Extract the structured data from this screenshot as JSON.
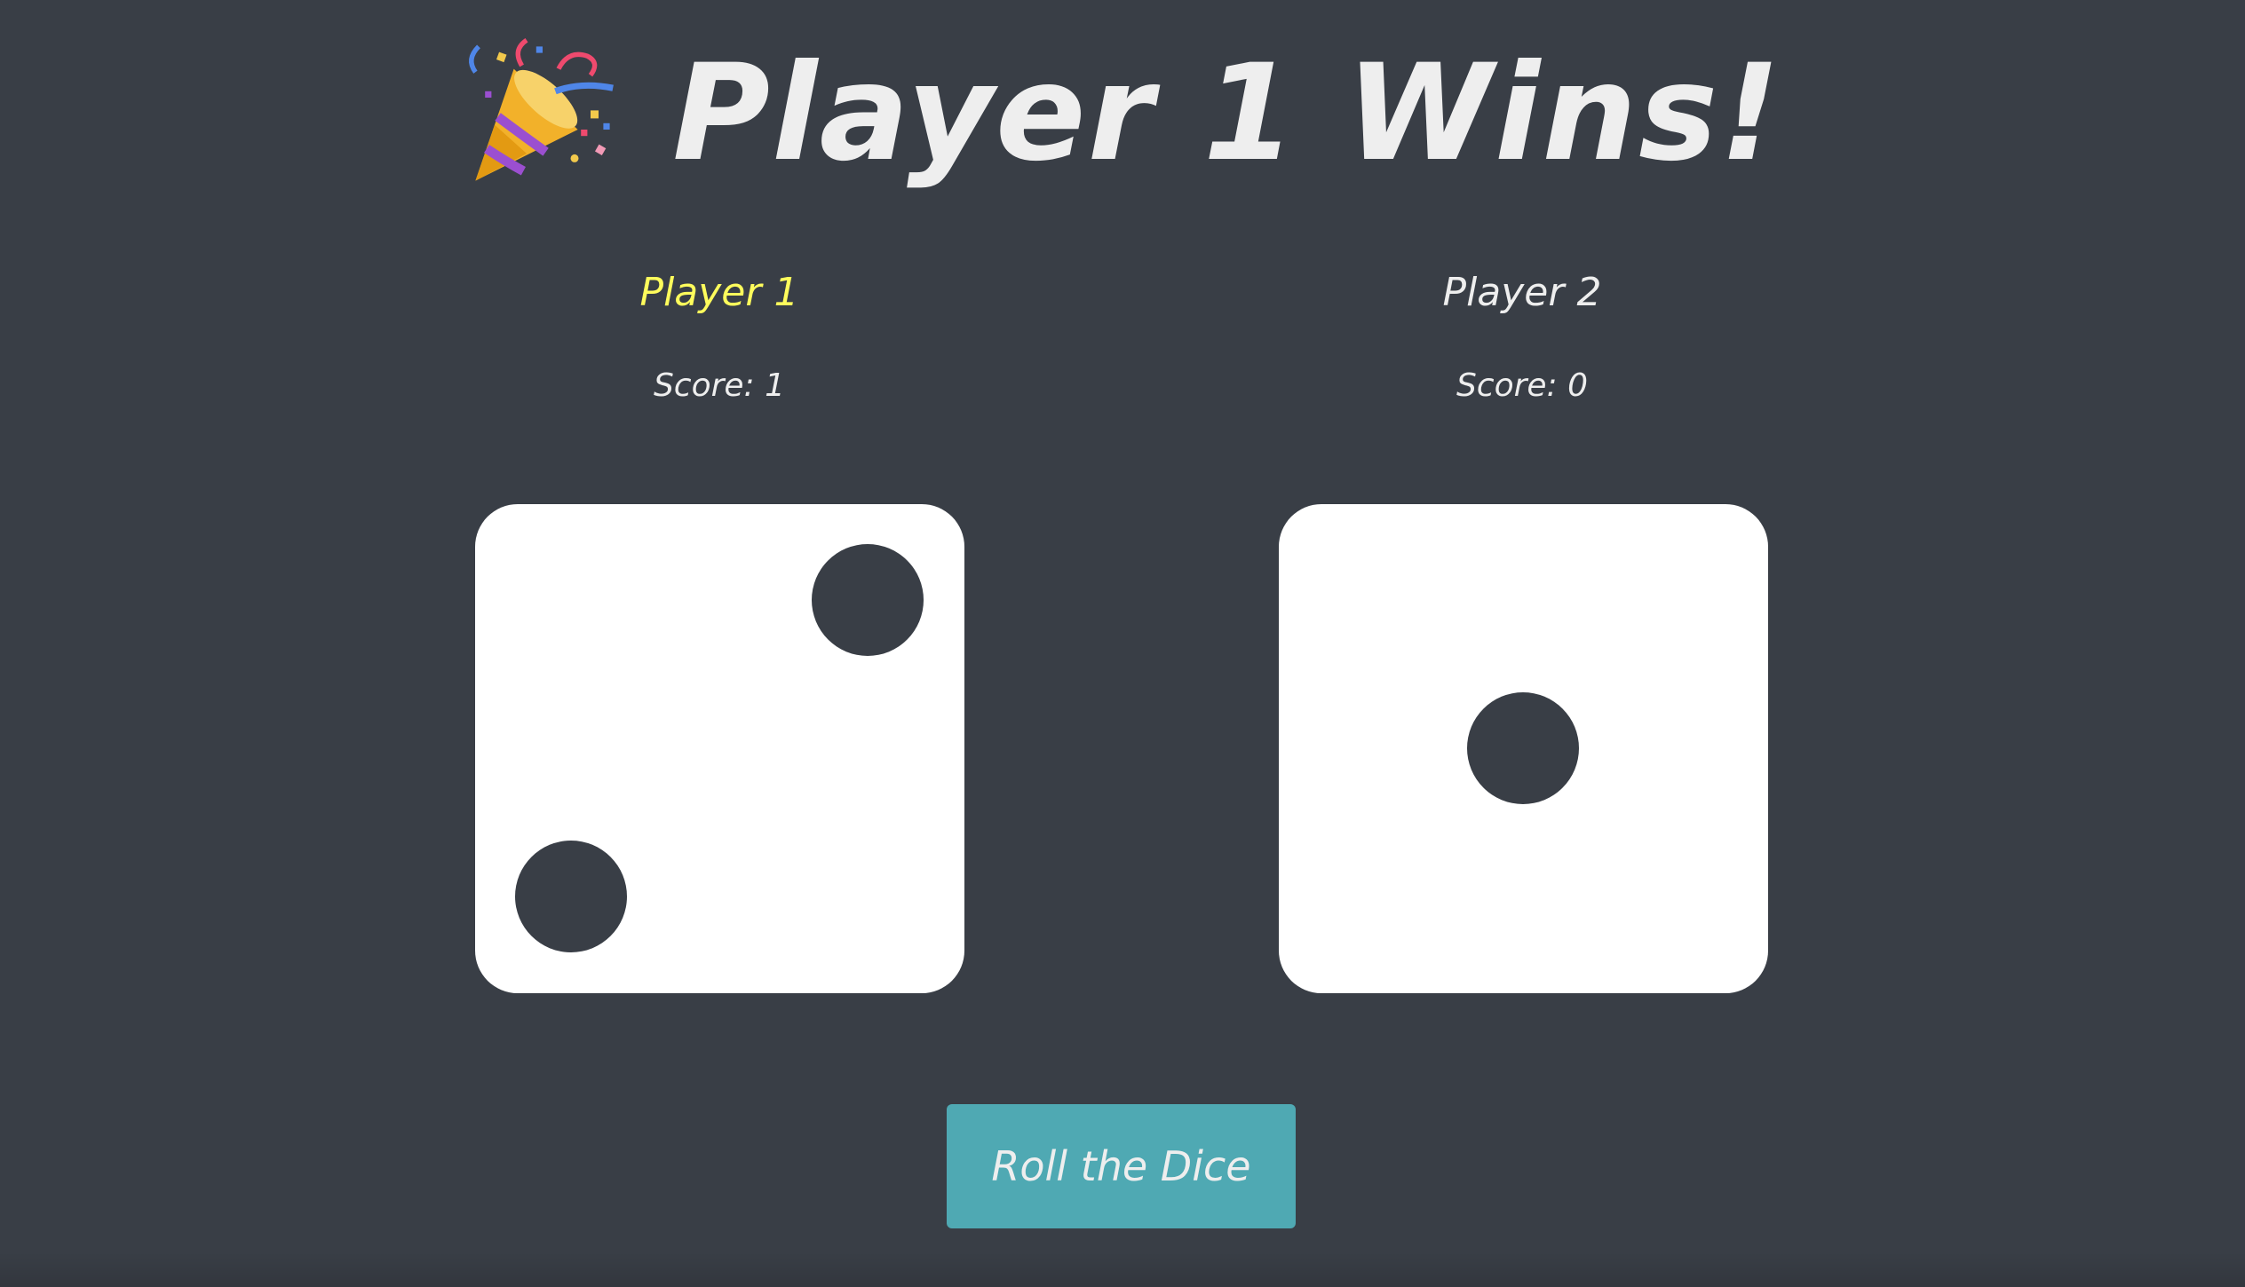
{
  "title": {
    "icon": "party-popper-icon",
    "text": "Player 1 Wins!"
  },
  "players": [
    {
      "name": "Player 1",
      "score_label": "Score:",
      "score": "1",
      "is_winner": true,
      "die_value": 2
    },
    {
      "name": "Player 2",
      "score_label": "Score:",
      "score": "0",
      "is_winner": false,
      "die_value": 1
    }
  ],
  "roll_button": {
    "label": "Roll the Dice"
  },
  "colors": {
    "background": "#393e46",
    "text": "#eeeeee",
    "winner_highlight": "#fffc5c",
    "button": "#4fa9b3",
    "die_face": "#ffffff",
    "pip": "#393e46"
  }
}
